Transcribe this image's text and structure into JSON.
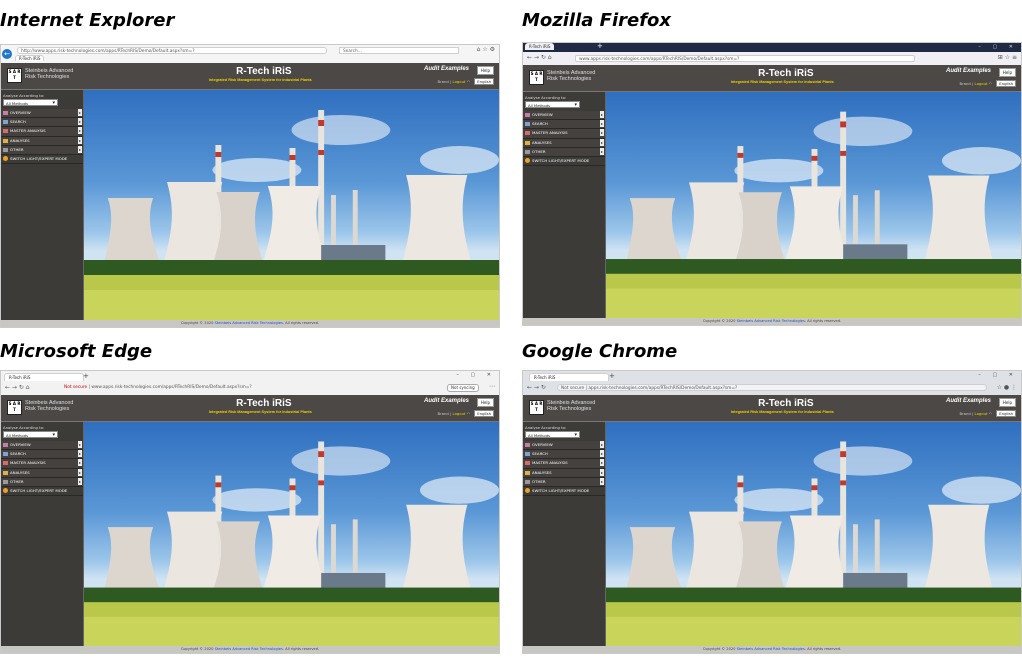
{
  "quadrants": [
    {
      "id": "ie",
      "title": "Internet Explorer",
      "tab": "R-Tech iRiS",
      "url": "http://www.apps.risk-technologies.com/apps/RTechRIS/Demo/Default.aspx?sm=?",
      "search_placeholder": "Search..."
    },
    {
      "id": "ff",
      "title": "Mozilla Firefox",
      "tab": "R-Tech iRiS",
      "url": "www.apps.risk-technologies.com/apps/RTechRIS/Demo/Default.aspx?sm=?"
    },
    {
      "id": "ed",
      "title": "Microsoft Edge",
      "tab": "R-Tech iRiS",
      "not_secure": "Not secure",
      "url": "www.apps.risk-technologies.com/apps/RTechRIS/Demo/Default.aspx?sm=?",
      "sync": "Not syncing"
    },
    {
      "id": "ch",
      "title": "Google Chrome",
      "tab": "R-Tech iRiS",
      "not_secure": "Not secure",
      "url": "apps.risk-technologies.com/apps/RTechRIS/Demo/Default.aspx?sm=?"
    }
  ],
  "app": {
    "logo_text": "S A R T",
    "company_line1": "Steinbeis Advanced",
    "company_line2": "Risk Technologies",
    "title": "R-Tech iRiS",
    "subtitle": "Integrated Risk Management System for Industrial Plants",
    "audit": "Audit Examples",
    "help": "Help",
    "user": "Brand",
    "logout": "Logout",
    "language": "English",
    "analyse_label": "Analyse According to:",
    "method": "All Methods",
    "menu": [
      "OVERVIEW",
      "SEARCH",
      "MASTER ANALYSIS",
      "ANALYSES",
      "OTHER"
    ],
    "mode_switch": "SWITCH LIGHT/EXPERT MODE",
    "footer_prefix": "Copyright © 2020",
    "footer_link": "Steinbeis Advanced Risk Technologies",
    "footer_suffix": ". All rights reserved."
  },
  "colors": {
    "header": "#4b4845",
    "sidebar": "#3d3b38",
    "accent_yellow": "#f0d000",
    "link": "#2050c0"
  }
}
